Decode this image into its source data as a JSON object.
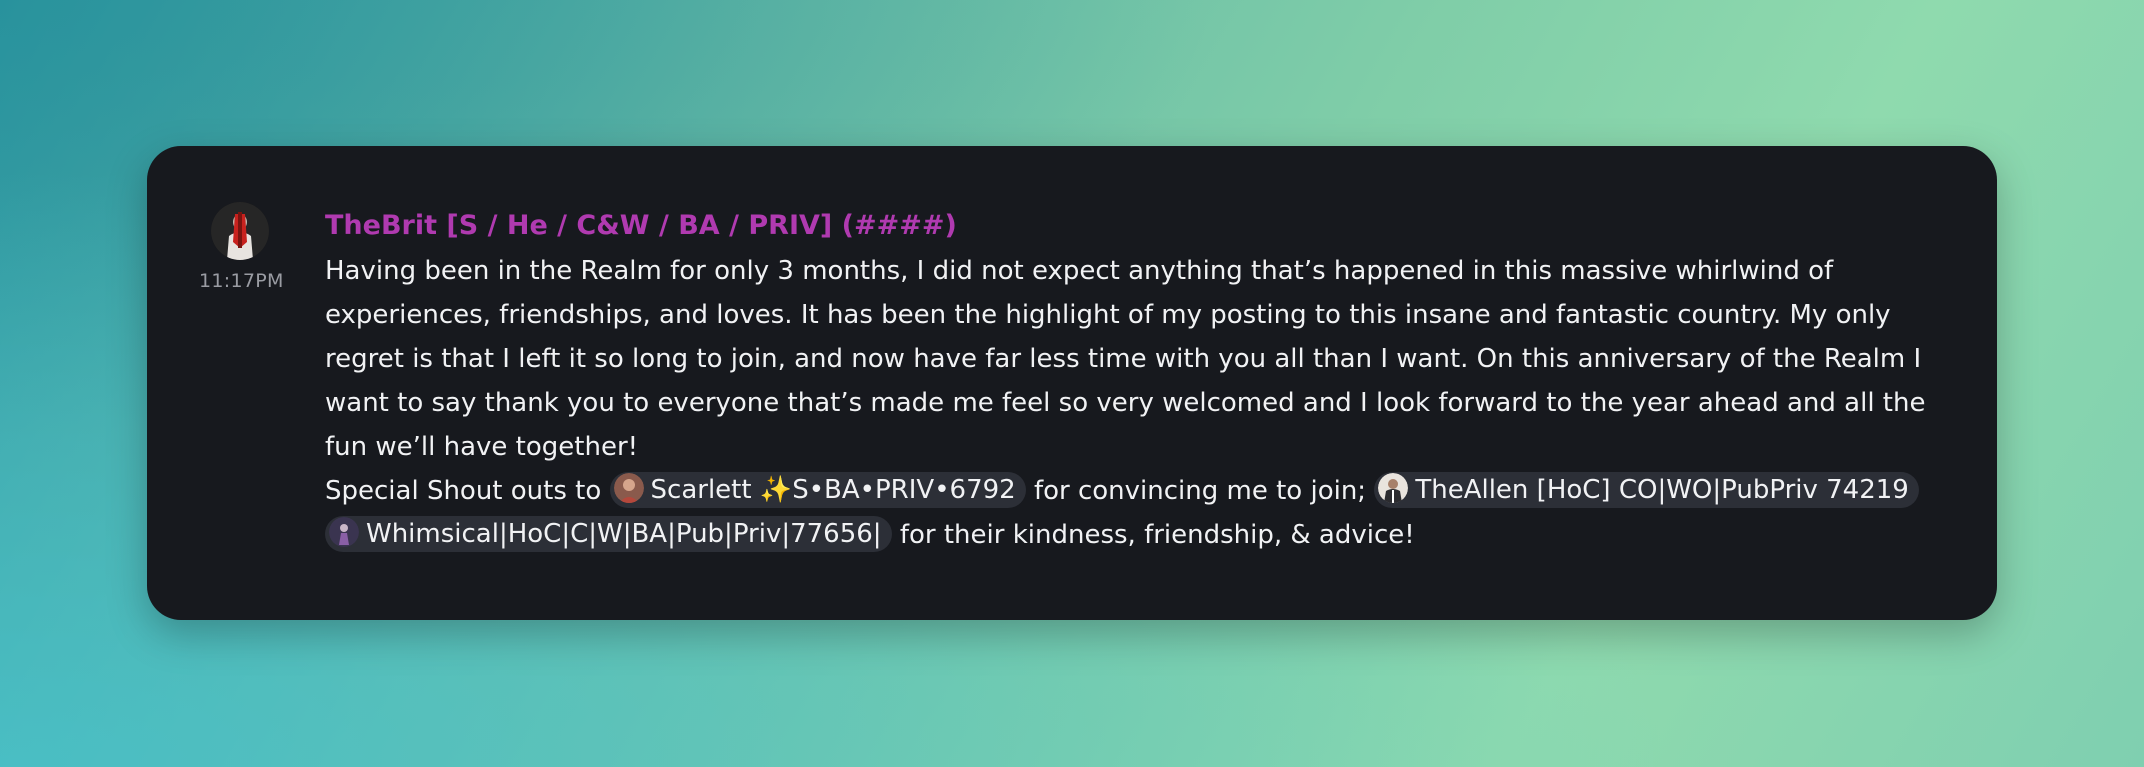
{
  "message": {
    "username": "TheBrit [S / He / C&W / BA / PRIV] (####)",
    "timestamp": "11:17PM",
    "paragraph": "Having been in the Realm for only 3 months, I did not expect anything that’s happened in this massive whirlwind of experiences, friendships, and loves. It has been the highlight of my posting to this insane and fantastic country. My only regret is that I left it so long to join, and now have far less time with you all than I want. On this anniversary of the Realm I want to say thank you to everyone that’s made me feel so very welcomed and I look forward to the year ahead and all the fun we’ll have together!",
    "shoutout_prefix": "Special Shout outs to",
    "mention_1": "Scarlett ✨S•BA•PRIV•6792",
    "middle_text": "for convincing me to join;",
    "mention_2": "TheAllen [HoC] CO|WO|PubPriv 74219",
    "mention_3": "Whimsical|HoC|C|W|BA|Pub|Priv|77656|",
    "suffix_text": "for their kindness, friendship, & advice!"
  },
  "colors": {
    "username": "#b03ab0",
    "card_background": "#17191e",
    "mention_background": "#2c2f37",
    "text": "#f1f2f4",
    "timestamp": "#9a9ca3"
  }
}
